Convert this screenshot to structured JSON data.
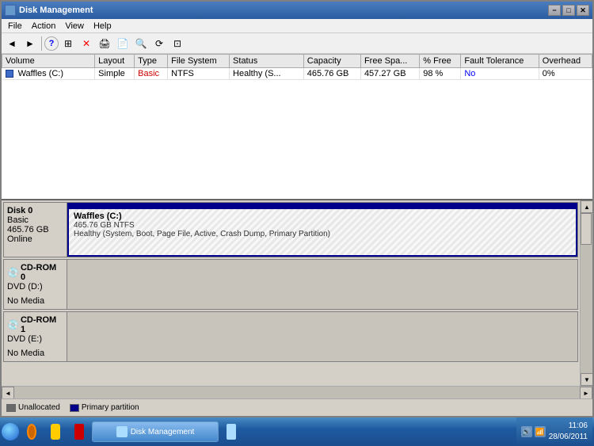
{
  "titlebar": {
    "title": "Disk Management",
    "minimize": "−",
    "maximize": "□",
    "close": "✕"
  },
  "menu": {
    "items": [
      "File",
      "Action",
      "View",
      "Help"
    ]
  },
  "toolbar": {
    "buttons": [
      "◄",
      "►",
      "⬆",
      "?",
      "▦",
      "✕",
      "⎙",
      "⎙",
      "🔍",
      "📋"
    ]
  },
  "table": {
    "columns": [
      "Volume",
      "Layout",
      "Type",
      "File System",
      "Status",
      "Capacity",
      "Free Spa...",
      "% Free",
      "Fault Tolerance",
      "Overhead"
    ],
    "rows": [
      {
        "volume": "Waffles (C:)",
        "layout": "Simple",
        "type": "Basic",
        "filesystem": "NTFS",
        "status": "Healthy (S...",
        "capacity": "465.76 GB",
        "free_space": "457.27 GB",
        "pct_free": "98 %",
        "fault_tolerance": "No",
        "overhead": "0%"
      }
    ]
  },
  "disks": {
    "disk0": {
      "name": "Disk 0",
      "type": "Basic",
      "size": "465.76 GB",
      "status": "Online",
      "partition_name": "Waffles (C:)",
      "partition_size": "465.76 GB NTFS",
      "partition_status": "Healthy (System, Boot, Page File, Active, Crash Dump, Primary Partition)"
    },
    "cdrom0": {
      "name": "CD-ROM 0",
      "drive": "DVD (D:)",
      "media": "No Media"
    },
    "cdrom1": {
      "name": "CD-ROM 1",
      "drive": "DVD (E:)",
      "media": "No Media"
    }
  },
  "legend": {
    "items": [
      {
        "label": "Unallocated",
        "color": "unallocated"
      },
      {
        "label": "Primary partition",
        "color": "primary"
      }
    ]
  },
  "taskbar": {
    "time": "11:06",
    "date": "28/06/2011",
    "apps": [
      {
        "label": "Disk Management",
        "active": true
      }
    ]
  }
}
